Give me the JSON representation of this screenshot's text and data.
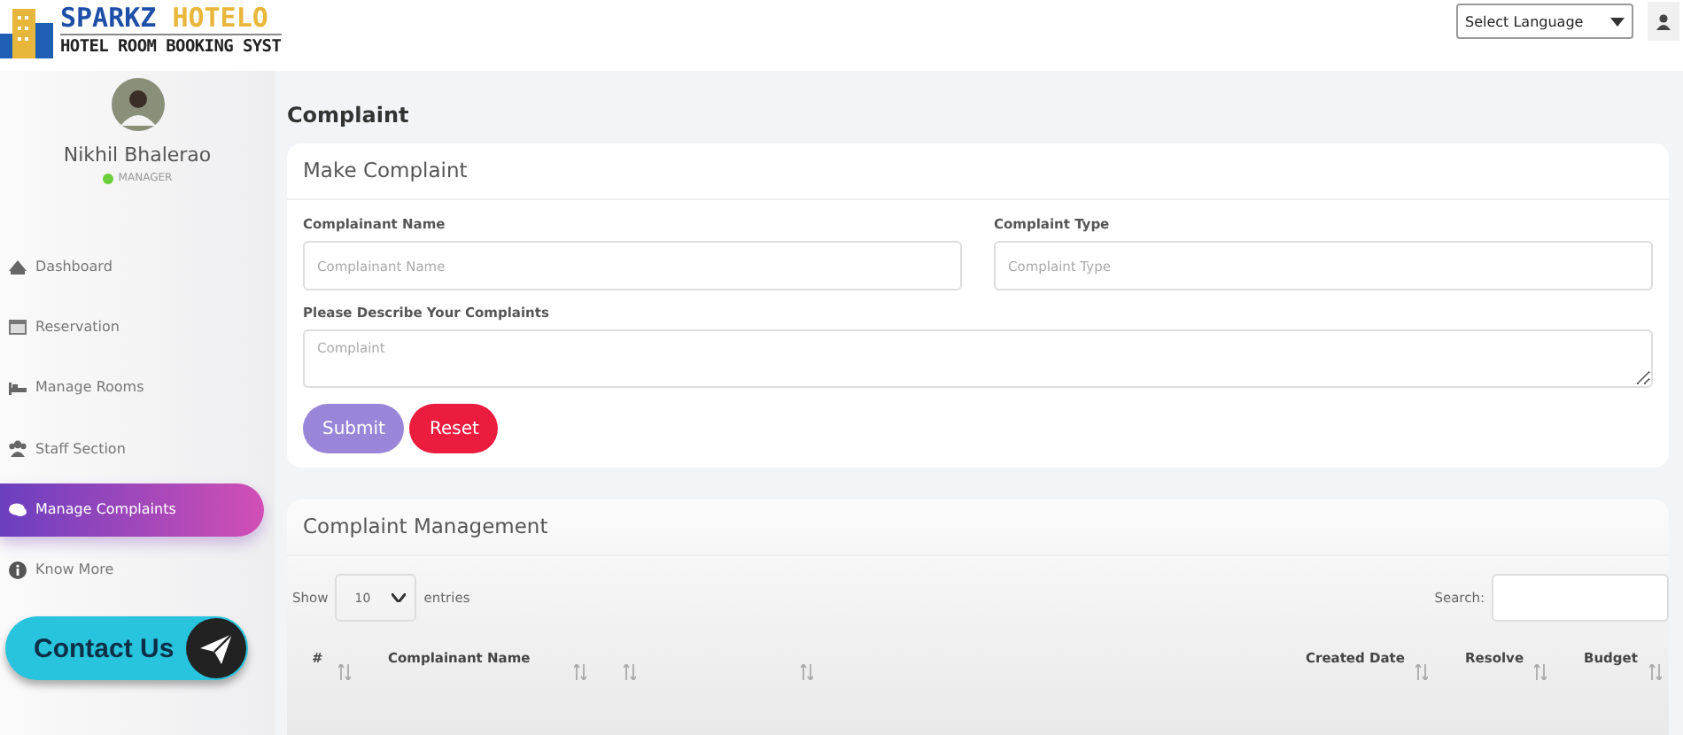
{
  "header": {
    "brand": "SPARKZ HOTELO",
    "tagline": "HOTEL ROOM BOOKING SYST",
    "language_select": {
      "value": "Select Language"
    }
  },
  "profile": {
    "name": "Nikhil Bhalerao",
    "role": "MANAGER",
    "online": true
  },
  "sidebar": {
    "items": [
      {
        "label": "Dashboard",
        "kind": "dashboard",
        "selected": false
      },
      {
        "label": "Reservation",
        "kind": "calendar",
        "selected": false
      },
      {
        "label": "Manage Rooms",
        "kind": "bed",
        "selected": false
      },
      {
        "label": "Staff Section",
        "kind": "users",
        "selected": false
      },
      {
        "label": "Manage Complaints",
        "kind": "chat",
        "selected": true
      },
      {
        "label": "Know More",
        "kind": "info",
        "selected": false
      }
    ],
    "contact_button": "Contact Us"
  },
  "page_title": "Complaint",
  "form": {
    "title": "Make Complaint",
    "fields": [
      {
        "label": "Complainant Name",
        "placeholder": "Complainant Name",
        "kind": "input"
      },
      {
        "label": "Complaint Type",
        "placeholder": "Complaint Type",
        "kind": "input"
      },
      {
        "label": "Please Describe Your Complaints",
        "placeholder": "Complaint",
        "kind": "textarea"
      }
    ],
    "buttons": [
      {
        "label": "Submit",
        "kind": "primary"
      },
      {
        "label": "Reset",
        "kind": "danger"
      }
    ]
  },
  "table": {
    "title": "Complaint Management",
    "show_label": "Show",
    "page_size": "10",
    "entries_label": "entries",
    "search_label": "Search:",
    "columns": [
      {
        "label": "#"
      },
      {
        "label": "Complainant Name"
      },
      {},
      {},
      {
        "label": "Created Date"
      },
      {
        "label": "Resolve"
      },
      {
        "label": "Budget"
      }
    ]
  }
}
